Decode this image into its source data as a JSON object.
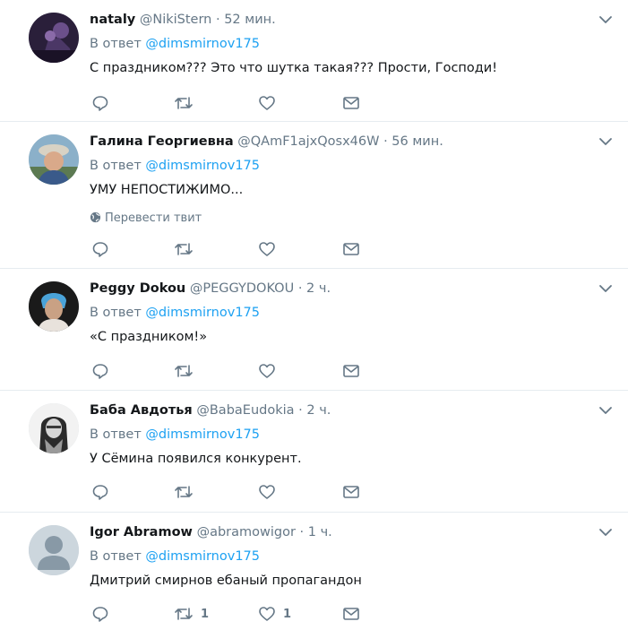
{
  "tweets": [
    {
      "name": "nataly",
      "handle": "@NikiStern",
      "time": "52 мин.",
      "reply_prefix": "В ответ",
      "reply_to": "@dimsmirnov175",
      "text": "С праздником??? Это что шутка такая??? Прости, Господи!",
      "avatar": "avatar-dark-purple",
      "retweet_count": "",
      "like_count": ""
    },
    {
      "name": "Галина Георгиевна",
      "handle": "@QAmF1ajxQosx46W",
      "time": "56 мин.",
      "reply_prefix": "В ответ",
      "reply_to": "@dimsmirnov175",
      "text": "УМУ НЕПОСТИЖИМО...",
      "translate": "Перевести твит",
      "avatar": "avatar-woman-hat",
      "retweet_count": "",
      "like_count": ""
    },
    {
      "name": "Peggy Dokou",
      "handle": "@PEGGYDOKOU",
      "time": "2 ч.",
      "reply_prefix": "В ответ",
      "reply_to": "@dimsmirnov175",
      "text": "«С праздником!»",
      "avatar": "avatar-woman-blue-scarf",
      "retweet_count": "",
      "like_count": ""
    },
    {
      "name": "Баба Авдотья",
      "handle": "@BabaEudokia",
      "time": "2 ч.",
      "reply_prefix": "В ответ",
      "reply_to": "@dimsmirnov175",
      "text": "У Сёмина появился конкурент.",
      "avatar": "avatar-grandma-bw",
      "retweet_count": "",
      "like_count": ""
    },
    {
      "name": "Igor Abramow",
      "handle": "@abramowigor",
      "time": "1 ч.",
      "reply_prefix": "В ответ",
      "reply_to": "@dimsmirnov175",
      "text": "Дмитрий смирнов ебаный пропагандон",
      "avatar": "avatar-default-silhouette",
      "retweet_count": "1",
      "like_count": "1"
    }
  ],
  "colors": {
    "link": "#1da1f2",
    "muted": "#657786",
    "text": "#14171a",
    "divider": "#e6ecf0"
  }
}
